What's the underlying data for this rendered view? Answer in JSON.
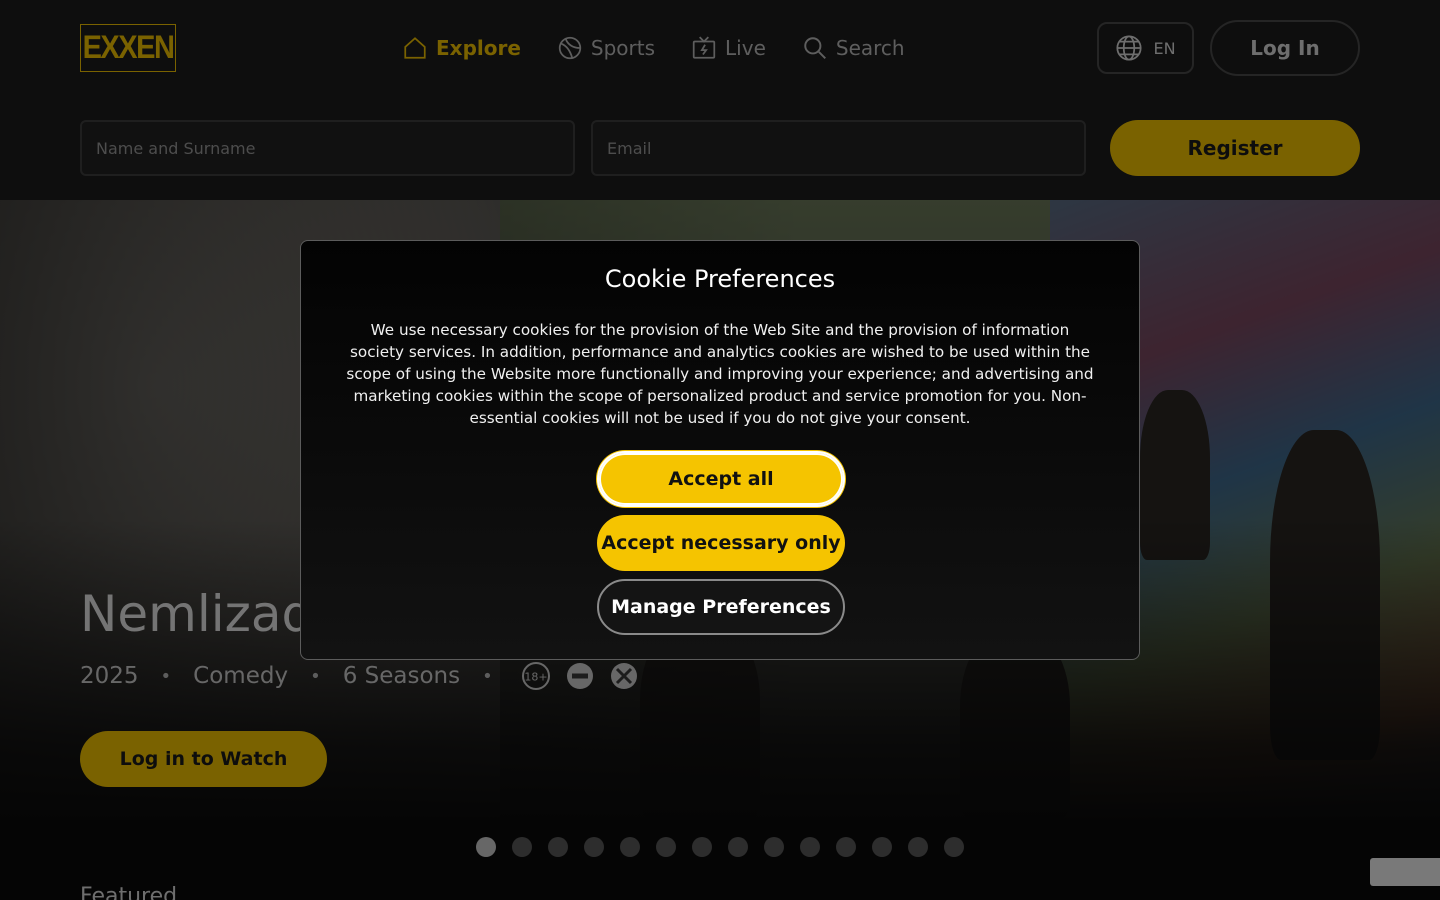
{
  "brand": {
    "logo_text": "EXXEN",
    "accent_color": "#f5c400"
  },
  "nav": {
    "items": [
      {
        "label": "Explore",
        "icon": "home-icon",
        "active": true
      },
      {
        "label": "Sports",
        "icon": "ball-icon",
        "active": false
      },
      {
        "label": "Live",
        "icon": "tv-icon",
        "active": false
      },
      {
        "label": "Search",
        "icon": "search-icon",
        "active": false
      }
    ]
  },
  "header": {
    "language": "EN",
    "login_label": "Log In"
  },
  "registration": {
    "name_placeholder": "Name and Surname",
    "email_placeholder": "Email",
    "register_label": "Register"
  },
  "hero": {
    "title": "Nemlizade",
    "year": "2025",
    "genre": "Comedy",
    "seasons": "6 Seasons",
    "separator": "•",
    "rating_icons": [
      "age-18-plus-icon",
      "negative-behaviour-icon",
      "violence-icon"
    ],
    "age_label": "18+",
    "watch_label": "Log in to Watch",
    "slide_count": 14,
    "active_slide": 1
  },
  "section": {
    "featured_label": "Featured"
  },
  "cookie_modal": {
    "title": "Cookie Preferences",
    "body": "We use necessary cookies for the provision of the Web Site and the provision of information society services. In addition, performance and analytics cookies are wished to be used within the scope of using the Website more functionally and improving your experience; and advertising and marketing cookies within the scope of personalized product and service promotion for you. Non-essential cookies will not be used if you do not give your consent.",
    "accept_all_label": "Accept all",
    "accept_necessary_label": "Accept necessary only",
    "manage_label": "Manage Preferences"
  }
}
